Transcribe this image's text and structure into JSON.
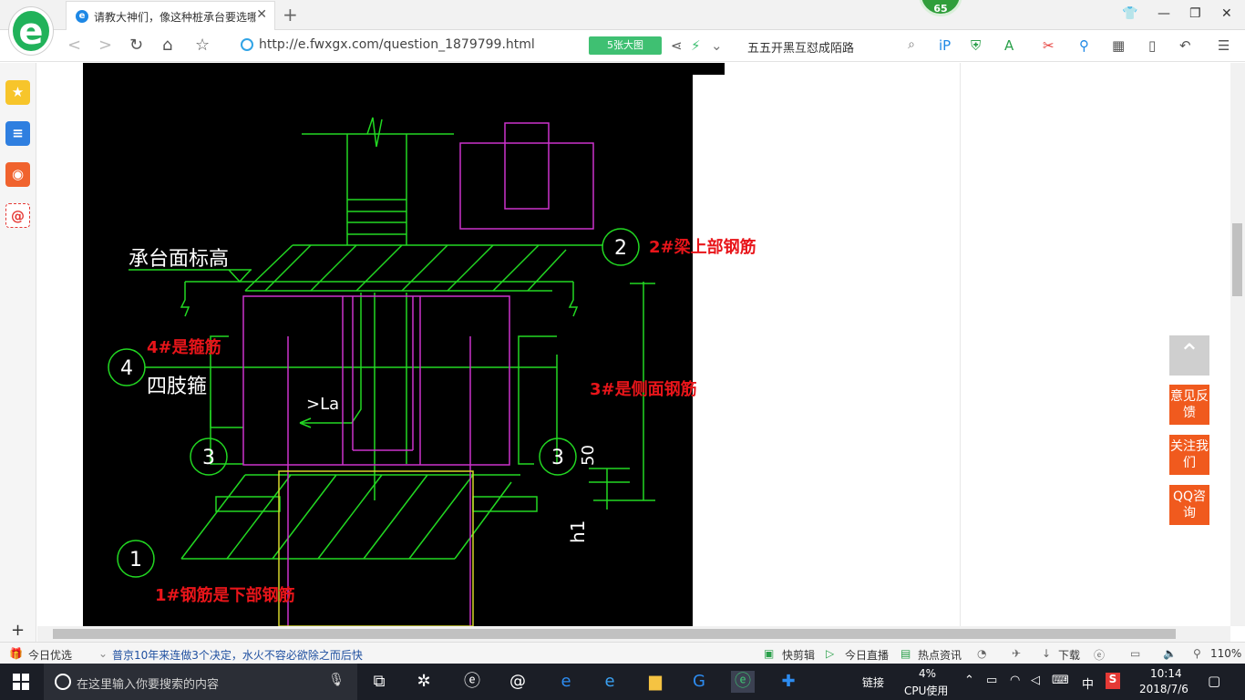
{
  "browser": {
    "tab_title": "请教大神们，像这种桩承台要选哪",
    "badge": "65",
    "url": "http://e.fwxgx.com/question_1879799.html",
    "bigimg_label": "5张大图",
    "search_text": "五五开黑互怼成陌路"
  },
  "content": {
    "annotations": {
      "a2": "2#梁上部钢筋",
      "a4": "4#是箍筋",
      "a3": "3#是侧面钢筋",
      "a1": "1#钢筋是下部钢筋"
    },
    "cad_labels": {
      "elevation": "承台面标高",
      "stirrup": "四肢箍",
      "anchor": ">La",
      "dim50": "50",
      "h1": "h1",
      "n1": "1",
      "n2": "2",
      "n3": "3",
      "n4": "4"
    },
    "float_buttons": {
      "feedback": "意见反馈",
      "follow": "关注我们",
      "qq": "QQ咨询"
    }
  },
  "statusbar": {
    "today": "今日优选",
    "news": "普京10年来连做3个决定，水火不容必欲除之而后快",
    "quickclip": "快剪辑",
    "live": "今日直播",
    "hotnews": "热点资讯",
    "download": "下载",
    "zoom": "110%"
  },
  "taskbar": {
    "search_placeholder": "在这里输入你要搜索的内容",
    "link": "链接",
    "cpu_percent": "4%",
    "cpu_label": "CPU使用",
    "ime": "中",
    "time": "10:14",
    "date": "2018/7/6"
  }
}
